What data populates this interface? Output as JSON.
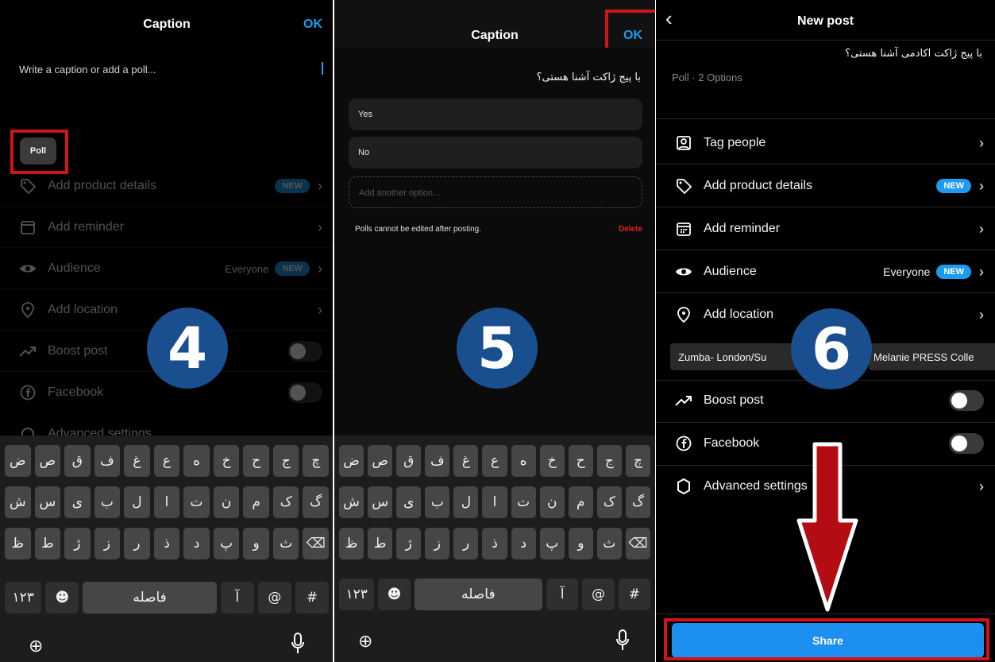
{
  "panel4": {
    "title": "Caption",
    "ok": "OK",
    "placeholder": "Write a caption or add a poll...",
    "poll_button": "Poll",
    "rows": {
      "product": "Add product details",
      "reminder": "Add reminder",
      "audience": "Audience",
      "audience_value": "Everyone",
      "location": "Add location",
      "boost": "Boost post",
      "facebook": "Facebook",
      "advanced": "Advanced settings"
    },
    "new_badge": "NEW",
    "step": "4"
  },
  "panel5": {
    "title": "Caption",
    "ok": "OK",
    "caption_text": "با پیج ژاکت آشنا هستی؟",
    "options": [
      "Yes",
      "No"
    ],
    "add_option_placeholder": "Add another option...",
    "note": "Polls cannot be edited after posting.",
    "delete": "Delete",
    "step": "5"
  },
  "panel6": {
    "title": "New post",
    "caption_text": "با پیج ژاکت اکادمی آشنا هستی؟",
    "poll_meta": "Poll · 2 Options",
    "rows": {
      "tag": "Tag people",
      "product": "Add product details",
      "reminder": "Add reminder",
      "audience": "Audience",
      "audience_value": "Everyone",
      "location": "Add location",
      "boost": "Boost post",
      "facebook": "Facebook",
      "advanced": "Advanced settings"
    },
    "new_badge": "NEW",
    "location_chips": [
      "Zumba- London/Su",
      "Melanie PRESS Colle"
    ],
    "share": "Share",
    "step": "6"
  },
  "keyboard": {
    "row1": [
      "ض",
      "ص",
      "ق",
      "ف",
      "غ",
      "ع",
      "ه",
      "خ",
      "ح",
      "ج",
      "چ"
    ],
    "row2": [
      "ش",
      "س",
      "ی",
      "ب",
      "ل",
      "ا",
      "ت",
      "ن",
      "م",
      "ک",
      "گ"
    ],
    "row3": [
      "ظ",
      "ط",
      "ژ",
      "ز",
      "ر",
      "ذ",
      "د",
      "پ",
      "و",
      "ث",
      "⌫"
    ],
    "numbers": "۱۲۳",
    "space": "فاصله",
    "alef": "آ",
    "at": "@",
    "hash": "#"
  },
  "icons": [
    "chevron-left-icon",
    "tag-person-icon",
    "price-tag-icon",
    "calendar-icon",
    "eye-icon",
    "location-pin-icon",
    "trend-arrow-icon",
    "facebook-icon",
    "gear-icon",
    "globe-icon",
    "mic-icon",
    "emoji-icon"
  ],
  "colors": {
    "accent": "#1d9bf0",
    "highlight": "#d0141a",
    "step_circle": "#1a4f8f"
  }
}
